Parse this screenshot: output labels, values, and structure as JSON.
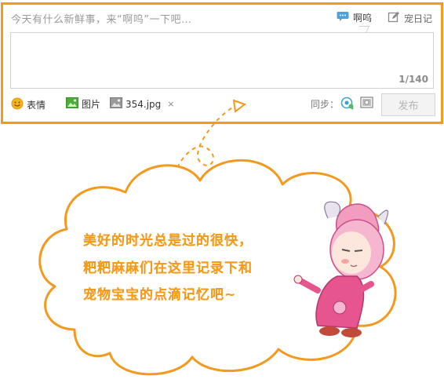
{
  "composer": {
    "prompt": "今天有什么新鲜事，来“啊呜”一下吧…",
    "mode_aowu_label": "啊呜",
    "mode_diary_label": "宠日记",
    "char_count": "1/140"
  },
  "toolbar": {
    "emotion_label": "表情",
    "photo_label": "图片",
    "attached_file": "354.jpg",
    "remove_symbol": "×",
    "sync_label": "同步：",
    "publish_label": "发布"
  },
  "illustration": {
    "lines": [
      "美好的时光总是过的很快，",
      "粑粑麻麻们在这里记录下和",
      "宠物宝宝的点滴记忆吧~"
    ]
  },
  "colors": {
    "accent_orange": "#f39a1e",
    "text_orange": "#f59b18",
    "disabled_button": "#f3f3f3"
  }
}
